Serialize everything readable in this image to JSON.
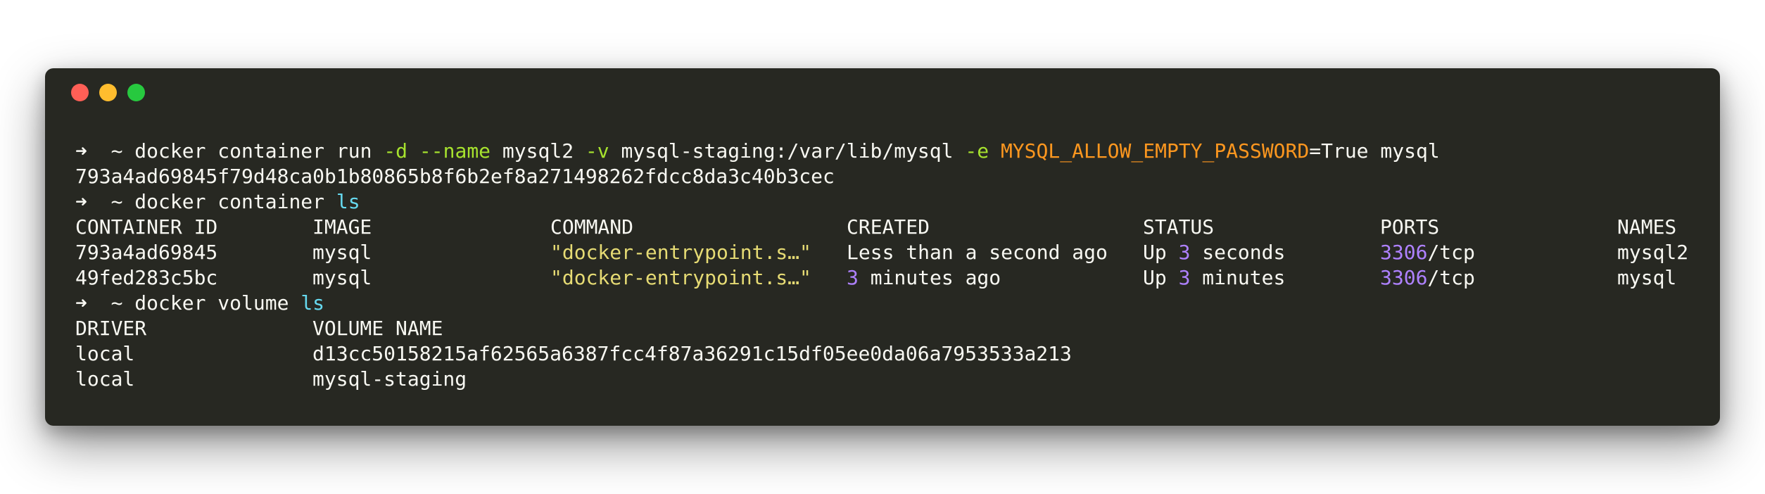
{
  "window": {
    "buttons": [
      "close",
      "minimize",
      "zoom"
    ]
  },
  "colors": {
    "background": "#272822",
    "text": "#f8f8f2",
    "flag": "#a6e22e",
    "env": "#fd971f",
    "keyword": "#66d9ef",
    "string": "#e6db74",
    "number": "#ae81ff"
  },
  "terminal": {
    "prompt_symbol": "➜",
    "prompt_dir": "~",
    "line1": {
      "cmd": "docker container run",
      "flag_d": "-d",
      "flag_name": "--name",
      "name_val": "mysql2",
      "flag_v": "-v",
      "volume_val": "mysql-staging:/var/lib/mysql",
      "flag_e": "-e",
      "env_key": "MYSQL_ALLOW_EMPTY_PASSWORD",
      "env_val": "=True",
      "image": "mysql"
    },
    "container_hash": "793a4ad69845f79d48ca0b1b80865b8f6b2ef8a271498262fdcc8da3c40b3cec",
    "line3": {
      "cmd": "docker container",
      "sub": "ls"
    },
    "ps_table": {
      "headers": [
        "CONTAINER ID",
        "IMAGE",
        "COMMAND",
        "CREATED",
        "STATUS",
        "PORTS",
        "NAMES"
      ],
      "rows": [
        {
          "id": "793a4ad69845",
          "image": "mysql",
          "command": "\"docker-entrypoint.s…\"",
          "created_text": "Less than a second ago",
          "status_pre": "Up ",
          "status_num": "3",
          "status_post": " seconds",
          "port_num": "3306",
          "port_rest": "/tcp",
          "name": "mysql2"
        },
        {
          "id": "49fed283c5bc",
          "image": "mysql",
          "command": "\"docker-entrypoint.s…\"",
          "created_num": "3",
          "created_rest": " minutes ago",
          "status_pre": "Up ",
          "status_num": "3",
          "status_post": " minutes",
          "port_num": "3306",
          "port_rest": "/tcp",
          "name": "mysql"
        }
      ]
    },
    "line7": {
      "cmd": "docker volume",
      "sub": "ls"
    },
    "volume_table": {
      "headers": [
        "DRIVER",
        "VOLUME NAME"
      ],
      "rows": [
        {
          "driver": "local",
          "name": "d13cc50158215af62565a6387fcc4f87a36291c15df05ee0da06a7953533a213"
        },
        {
          "driver": "local",
          "name": "mysql-staging"
        }
      ]
    }
  }
}
